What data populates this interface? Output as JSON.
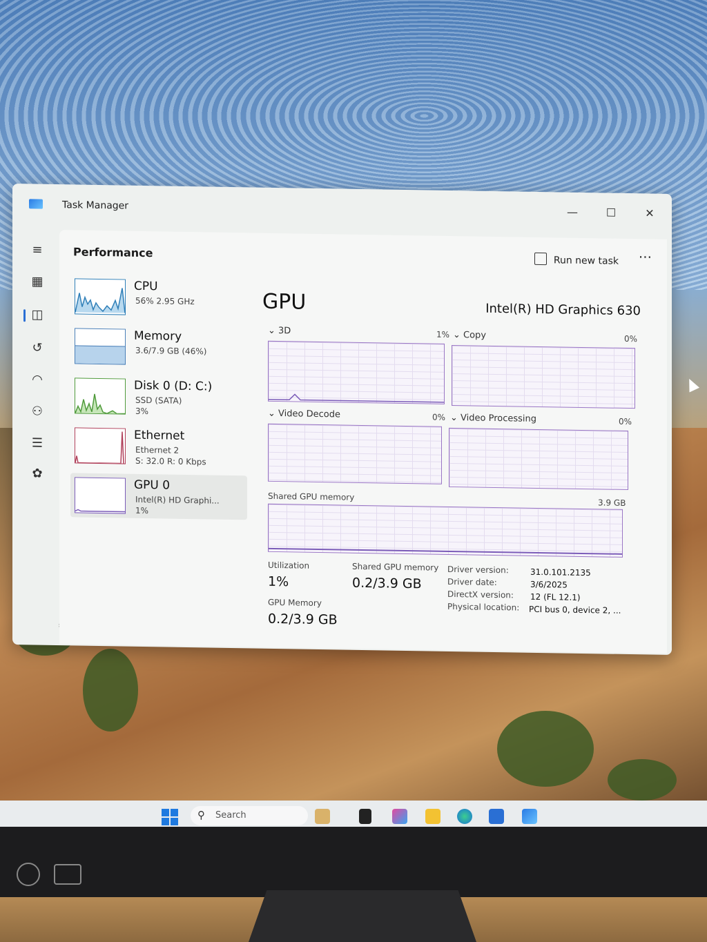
{
  "window": {
    "title": "Task Manager"
  },
  "controls": {
    "minimize": "—",
    "maximize": "☐",
    "close": "✕"
  },
  "header": {
    "title": "Performance",
    "run_new_task": "Run new task",
    "more": "···"
  },
  "sidebar_icons": [
    "menu-icon",
    "processes-icon",
    "performance-icon",
    "app-history-icon",
    "startup-apps-icon",
    "users-icon",
    "details-icon",
    "services-icon",
    "settings-icon"
  ],
  "devices": [
    {
      "name": "CPU",
      "sub1": "56% 2.95 GHz",
      "sub2": "",
      "sub3": ""
    },
    {
      "name": "Memory",
      "sub1": "3.6/7.9 GB (46%)",
      "sub2": "",
      "sub3": ""
    },
    {
      "name": "Disk 0 (D: C:)",
      "sub1": "SSD (SATA)",
      "sub2": "3%",
      "sub3": ""
    },
    {
      "name": "Ethernet",
      "sub1": "Ethernet 2",
      "sub2": "S: 32.0 R: 0 Kbps",
      "sub3": ""
    },
    {
      "name": "GPU 0",
      "sub1": "Intel(R) HD Graphi...",
      "sub2": "1%",
      "sub3": ""
    }
  ],
  "gpu": {
    "title": "GPU",
    "model": "Intel(R) HD Graphics 630",
    "engines": [
      {
        "label": "3D",
        "value": "1%"
      },
      {
        "label": "Copy",
        "value": "0%"
      },
      {
        "label": "Video Decode",
        "value": "0%"
      },
      {
        "label": "Video Processing",
        "value": "0%"
      }
    ],
    "shared_label": "Shared GPU memory",
    "shared_max": "3.9 GB",
    "stats": {
      "utilization_label": "Utilization",
      "utilization_value": "1%",
      "shared_mem_label": "Shared GPU memory",
      "shared_mem_value": "0.2/3.9 GB",
      "gpu_mem_label": "GPU Memory",
      "gpu_mem_value": "0.2/3.9 GB"
    },
    "details": [
      {
        "k": "Driver version:",
        "v": "31.0.101.2135"
      },
      {
        "k": "Driver date:",
        "v": "3/6/2025"
      },
      {
        "k": "DirectX version:",
        "v": "12 (FL 12.1)"
      },
      {
        "k": "Physical location:",
        "v": "PCI bus 0, device 2, ..."
      }
    ]
  },
  "taskbar": {
    "search_placeholder": "Search"
  }
}
